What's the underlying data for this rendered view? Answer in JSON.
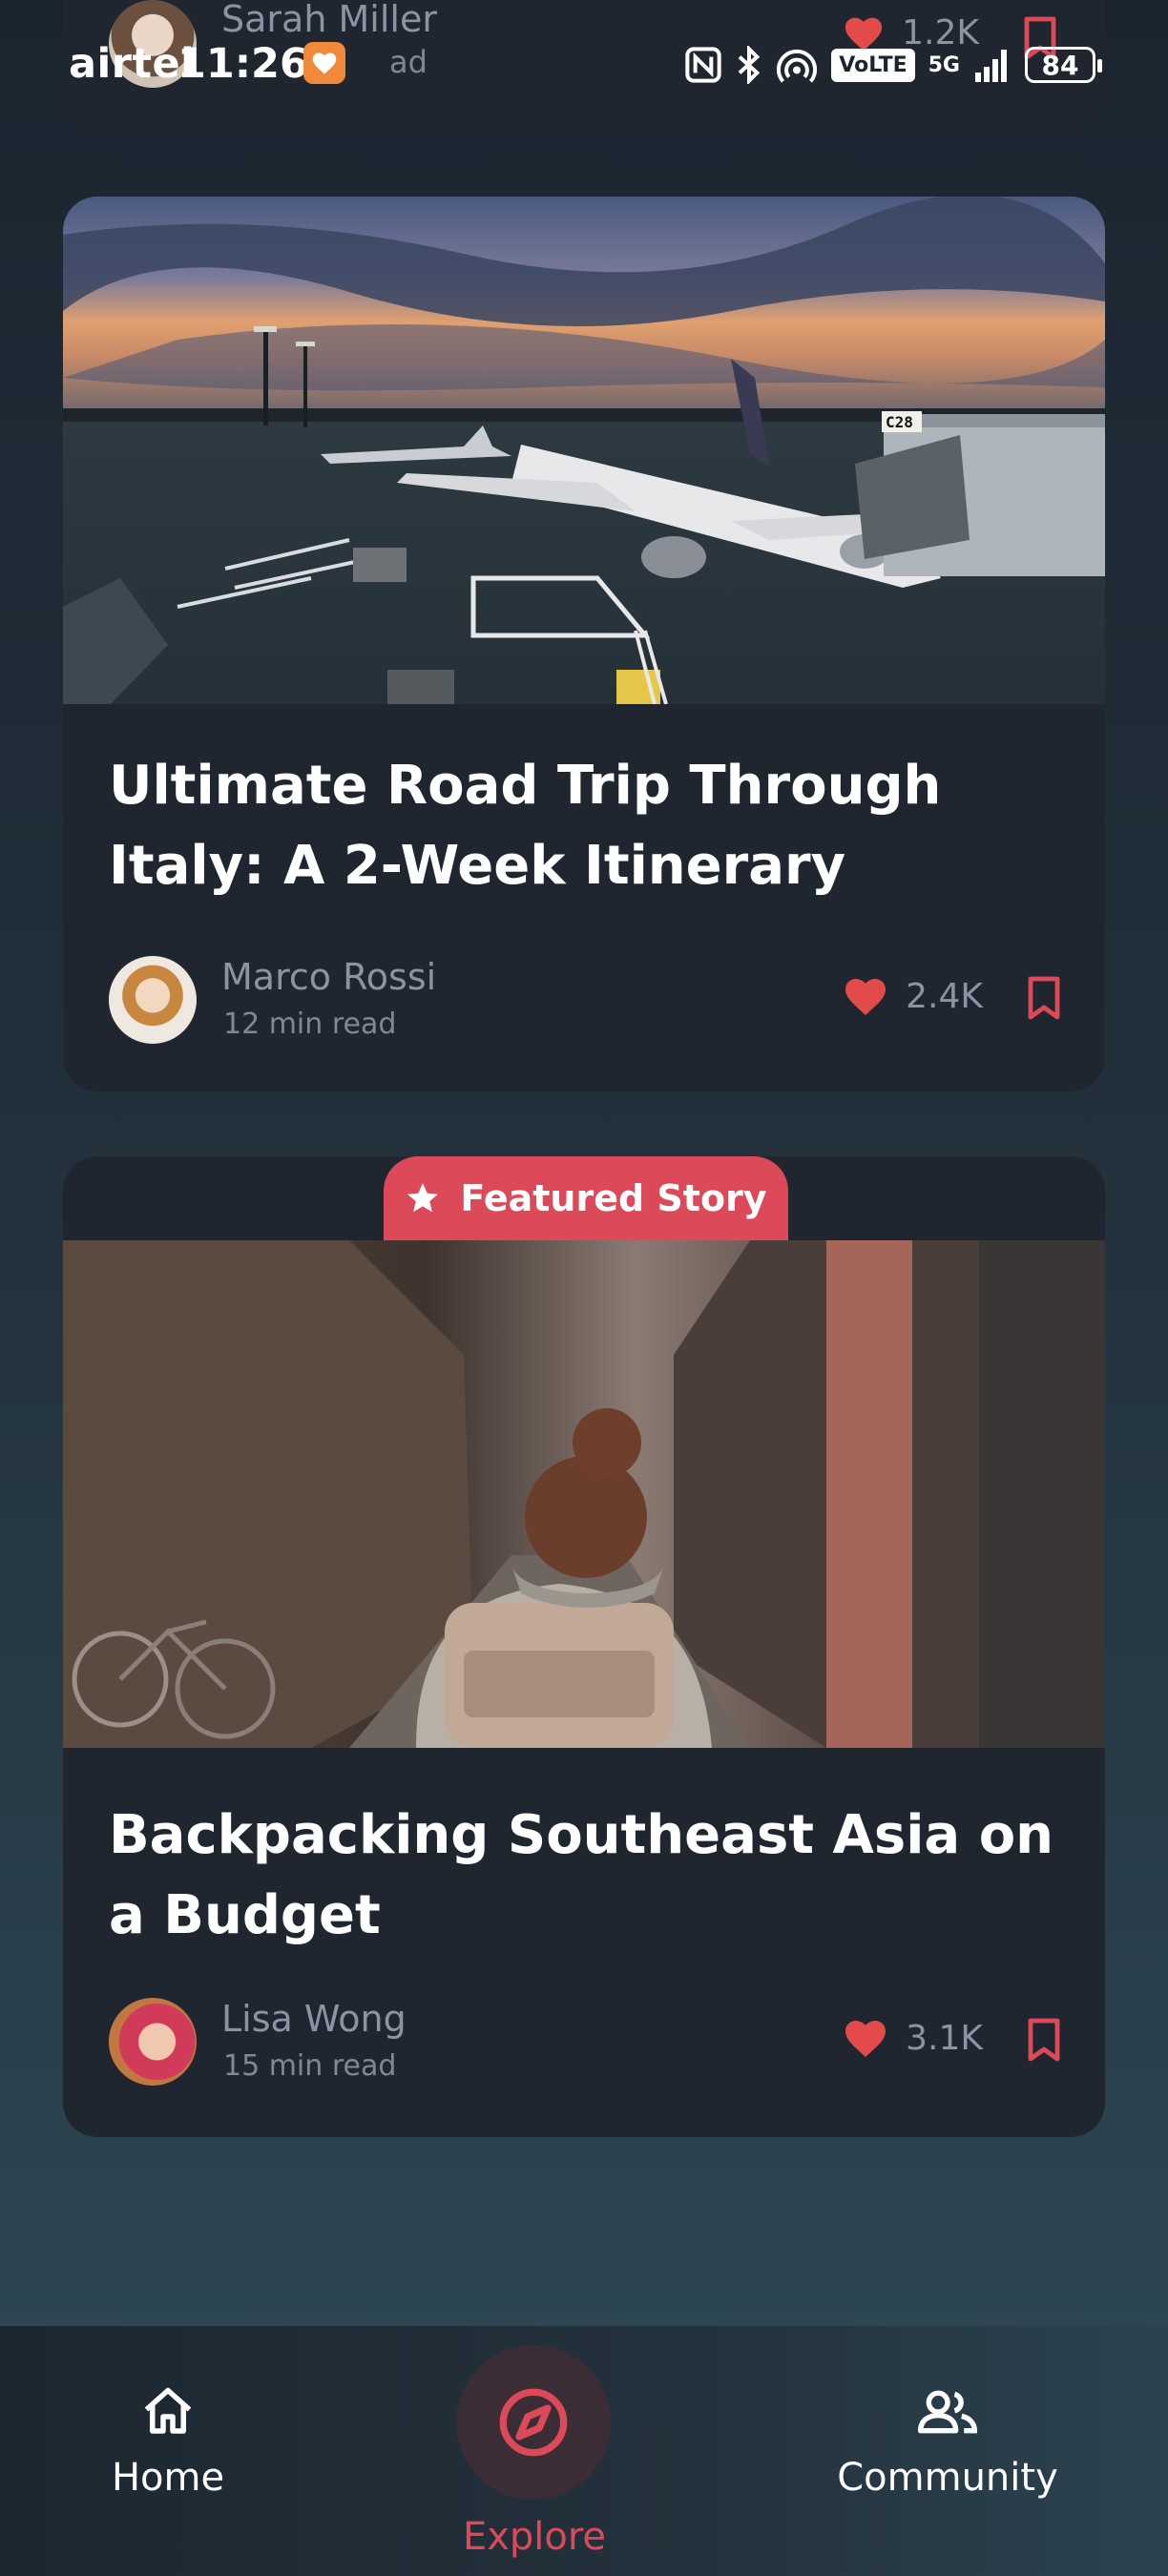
{
  "status_bar": {
    "carrier": "airtel",
    "time": "11:26",
    "battery": "84",
    "volte": "VoLTE",
    "network": "5G",
    "icons": [
      "nfc-icon",
      "bluetooth-icon",
      "hotspot-icon",
      "volte-icon",
      "signal-icon",
      "battery-icon"
    ]
  },
  "articles": [
    {
      "author": "Sarah Miller",
      "read_time": "ad",
      "likes": "1.2K"
    },
    {
      "title": "Ultimate Road Trip Through Italy: A 2-Week Itinerary",
      "author": "Marco Rossi",
      "read_time": "12 min read",
      "likes": "2.4K",
      "image": "airport-sunset-photo"
    },
    {
      "badge": "Featured Story",
      "title": "Backpacking Southeast Asia on a Budget",
      "author": "Lisa Wong",
      "read_time": "15 min read",
      "likes": "3.1K",
      "image": "backpacker-alley-photo"
    }
  ],
  "bottom_nav": {
    "home": "Home",
    "explore": "Explore",
    "community": "Community",
    "active": "explore"
  },
  "colors": {
    "accent": "#dc4a5a",
    "card": "#1f2630",
    "heart": "#e34a4a",
    "muted_text": "#8b94a3"
  }
}
